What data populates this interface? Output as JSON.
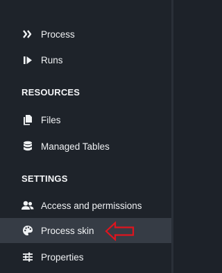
{
  "nav_top": [
    {
      "label": "Process",
      "icon": "double-chevron-right-icon"
    },
    {
      "label": "Runs",
      "icon": "skip-forward-icon"
    }
  ],
  "resources": {
    "title": "RESOURCES",
    "items": [
      {
        "label": "Files",
        "icon": "files-icon"
      },
      {
        "label": "Managed Tables",
        "icon": "database-icon"
      }
    ]
  },
  "settings": {
    "title": "SETTINGS",
    "items": [
      {
        "label": "Access and permissions",
        "icon": "users-icon"
      },
      {
        "label": "Process skin",
        "icon": "palette-icon",
        "active": true
      },
      {
        "label": "Properties",
        "icon": "sliders-icon"
      }
    ]
  },
  "colors": {
    "background": "#1e232a",
    "active_item": "#363c45",
    "annotation_arrow": "#e0141e"
  }
}
